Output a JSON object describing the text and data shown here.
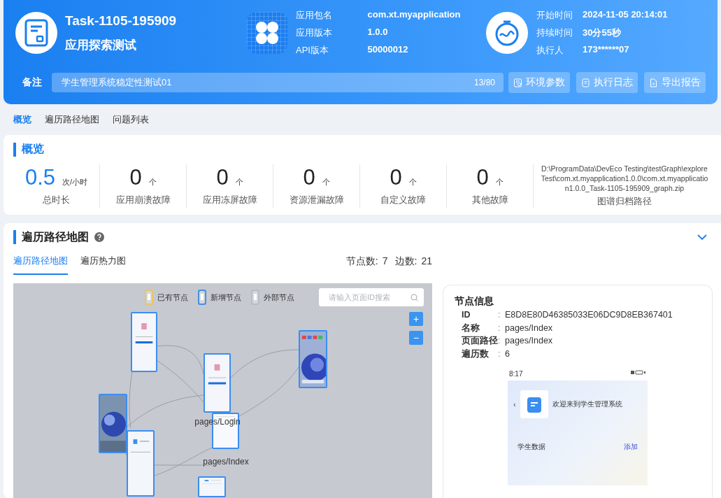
{
  "header": {
    "task_id": "Task-1105-195909",
    "task_type": "应用探索测试",
    "app_info": [
      {
        "label": "应用包名",
        "value": "com.xt.myapplication"
      },
      {
        "label": "应用版本",
        "value": "1.0.0"
      },
      {
        "label": "API版本",
        "value": "50000012"
      }
    ],
    "run_info": [
      {
        "label": "开始时间",
        "value": "2024-11-05 20:14:01"
      },
      {
        "label": "持续时间",
        "value": "30分55秒"
      },
      {
        "label": "执行人",
        "value": "173******07"
      }
    ],
    "remark": {
      "label": "备注",
      "value": "学生管理系统稳定性测试01",
      "count": "13/80"
    },
    "buttons": [
      {
        "label": "环境参数",
        "kind": "params"
      },
      {
        "label": "执行日志",
        "kind": "log"
      },
      {
        "label": "导出报告",
        "kind": "export"
      }
    ]
  },
  "nav_tabs": [
    {
      "label": "概览",
      "selected": true
    },
    {
      "label": "遍历路径地图",
      "selected": false
    },
    {
      "label": "问题列表",
      "selected": false
    }
  ],
  "overview": {
    "title": "概览",
    "stats": [
      {
        "value": "0.5",
        "unit": "次/小时",
        "label": "总时长",
        "kind": "primary"
      },
      {
        "value": "0",
        "unit": "个",
        "label": "应用崩溃故障",
        "kind": "count"
      },
      {
        "value": "0",
        "unit": "个",
        "label": "应用冻屏故障",
        "kind": "count"
      },
      {
        "value": "0",
        "unit": "个",
        "label": "资源泄漏故障",
        "kind": "count"
      },
      {
        "value": "0",
        "unit": "个",
        "label": "自定义故障",
        "kind": "count"
      },
      {
        "value": "0",
        "unit": "个",
        "label": "其他故障",
        "kind": "count"
      }
    ],
    "archive": {
      "path": "D:\\ProgramData\\DevEco Testing\\testGraph\\exploreTest\\com.xt.myapplication1.0.0\\com.xt.myapplication1.0.0_Task-1105-195909_graph.zip",
      "label": "图谱归档路径"
    }
  },
  "map_section": {
    "title": "遍历路径地图",
    "tabs": [
      {
        "label": "遍历路径地图",
        "selected": true
      },
      {
        "label": "遍历热力图",
        "selected": false
      }
    ],
    "node_count_label": "节点数:",
    "node_count": "7",
    "edge_count_label": "边数:",
    "edge_count": "21",
    "legend": [
      {
        "label": "已有节点",
        "color": "#e8c46a"
      },
      {
        "label": "新增节点",
        "color": "#4a90e2"
      },
      {
        "label": "外部节点",
        "color": "#b8bcc4"
      }
    ],
    "search": {
      "placeholder": "请输入页面ID搜索"
    },
    "zoom_buttons": [
      "+",
      "−"
    ],
    "nodes": [
      {
        "kind": "login"
      },
      {
        "kind": "login",
        "label": "pages/Login"
      },
      {
        "kind": "index",
        "label": "pages/Index"
      },
      {
        "kind": "home"
      },
      {
        "kind": "wallpaper"
      },
      {
        "kind": "app"
      },
      {
        "kind": "app"
      }
    ],
    "node_info": {
      "title": "节点信息",
      "fields": [
        {
          "label": "ID",
          "colon": ":",
          "value": "E8D8E80D46385033E06DC9D8EB367401"
        },
        {
          "label": "名称",
          "colon": ":",
          "value": "pages/Index"
        },
        {
          "label": "页面路径",
          "colon": ":",
          "value": "pages/Index"
        },
        {
          "label": "遍历数",
          "colon": ":",
          "value": "6"
        }
      ],
      "preview": {
        "time": "8:17",
        "back": "‹",
        "heading": "欢迎来到学生管理系统",
        "list_title": "学生数据",
        "action": "添加"
      }
    }
  }
}
